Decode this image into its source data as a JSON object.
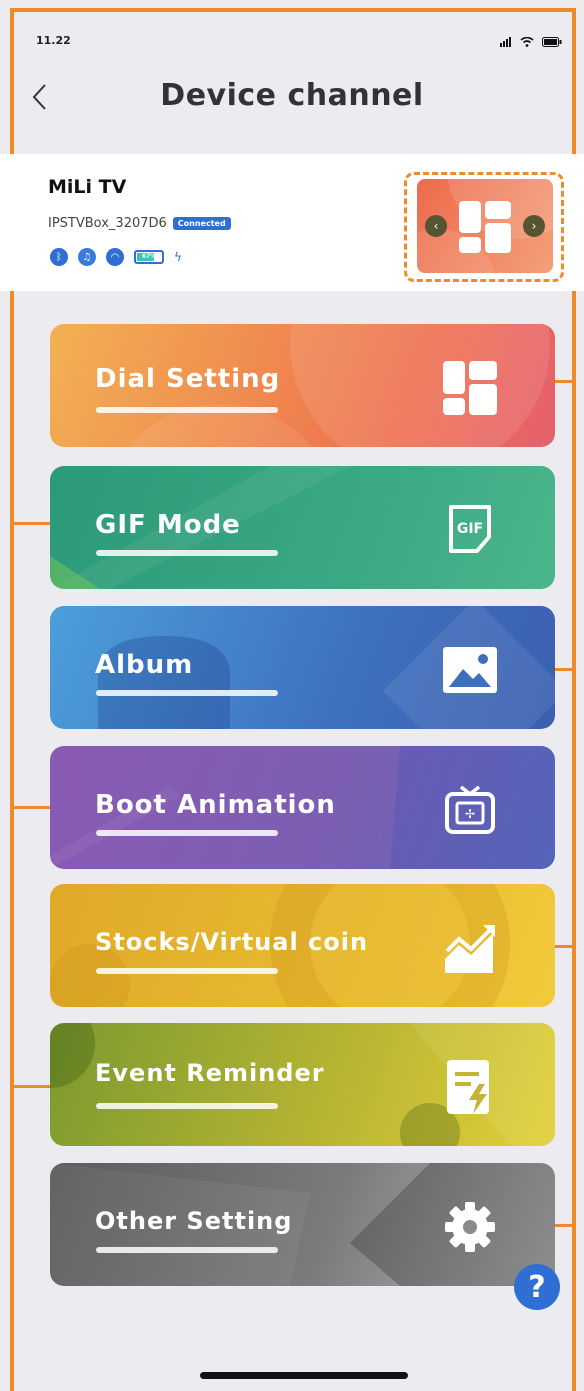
{
  "status_bar": {
    "time": "11.22"
  },
  "nav": {
    "title": "Device channel"
  },
  "device": {
    "name": "MiLi TV",
    "id": "IPSTVBox_3207D6",
    "status": "Connected",
    "battery": "67%"
  },
  "menu": [
    {
      "label": "Dial Setting",
      "icon": "dial-grid-icon",
      "colors": [
        "#f2b152",
        "#ee6f4e"
      ]
    },
    {
      "label": "GIF Mode",
      "icon": "gif-icon",
      "colors": [
        "#2f9c7b",
        "#44b38d"
      ]
    },
    {
      "label": "Album",
      "icon": "image-icon",
      "colors": [
        "#4d9bd9",
        "#3f69b5"
      ]
    },
    {
      "label": "Boot Animation",
      "icon": "tv-fan-icon",
      "colors": [
        "#8a5ab3",
        "#5d6bbb"
      ]
    },
    {
      "label": "Stocks/Virtual coin",
      "icon": "chart-trend-icon",
      "colors": [
        "#e3ad27",
        "#f1cb3a"
      ]
    },
    {
      "label": "Event Reminder",
      "icon": "reminder-doc-icon",
      "colors": [
        "#7f9d2e",
        "#e0cd38"
      ]
    },
    {
      "label": "Other Setting",
      "icon": "gear-icon",
      "colors": [
        "#5c5c5c",
        "#b7b7b7"
      ]
    }
  ],
  "help": {
    "label": "?"
  }
}
